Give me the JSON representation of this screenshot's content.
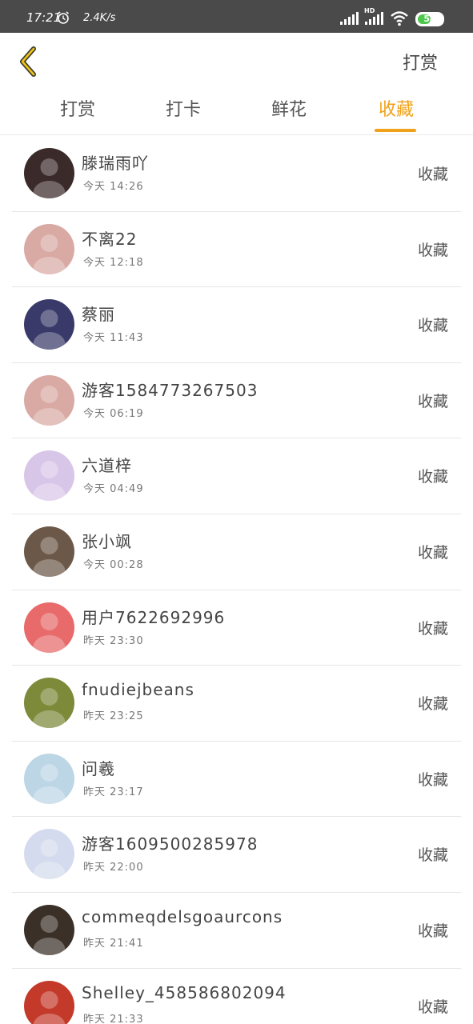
{
  "status_bar": {
    "time": "17:21",
    "speed": "2.4K/s",
    "battery": "54",
    "battery_level": 0.54,
    "hd_label": "HD"
  },
  "header": {
    "action_label": "打赏"
  },
  "tabs": [
    {
      "label": "打赏"
    },
    {
      "label": "打卡"
    },
    {
      "label": "鲜花"
    },
    {
      "label": "收藏",
      "active": true
    }
  ],
  "accent_color": "#f0a21b",
  "items": [
    {
      "name": "滕瑞雨吖",
      "time": "今天 14:26",
      "action": "收藏",
      "avatar_color": "#3b2a2a"
    },
    {
      "name": "不离22",
      "time": "今天 12:18",
      "action": "收藏",
      "avatar_color": "#d9a9a4"
    },
    {
      "name": "蔡丽",
      "time": "今天 11:43",
      "action": "收藏",
      "avatar_color": "#3a3a6a"
    },
    {
      "name": "游客1584773267503",
      "time": "今天 06:19",
      "action": "收藏",
      "avatar_color": "#d9a9a4"
    },
    {
      "name": "六道梓",
      "time": "今天 04:49",
      "action": "收藏",
      "avatar_color": "#d8c6e8"
    },
    {
      "name": "张小飒",
      "time": "今天 00:28",
      "action": "收藏",
      "avatar_color": "#6b5848"
    },
    {
      "name": "用户7622692996",
      "time": "昨天 23:30",
      "action": "收藏",
      "avatar_color": "#e86a6a"
    },
    {
      "name": "fnudiejbeans",
      "time": "昨天 23:25",
      "action": "收藏",
      "avatar_color": "#7c8a3a"
    },
    {
      "name": "问羲",
      "time": "昨天 23:17",
      "action": "收藏",
      "avatar_color": "#bcd6e6"
    },
    {
      "name": "游客1609500285978",
      "time": "昨天 22:00",
      "action": "收藏",
      "avatar_color": "#d5dbee"
    },
    {
      "name": "commeqdelsgoaurcons",
      "time": "昨天 21:41",
      "action": "收藏",
      "avatar_color": "#3a3028"
    },
    {
      "name": "Shelley_458586802094",
      "time": "昨天 21:33",
      "action": "收藏",
      "avatar_color": "#c43a2a"
    }
  ]
}
